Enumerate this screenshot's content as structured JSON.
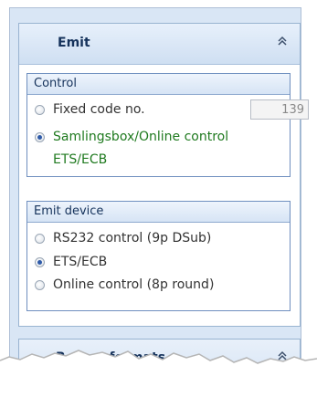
{
  "emit_panel": {
    "title": "Emit",
    "collapse_icon": "double-chevron-up-icon",
    "collapse_glyph": "≈"
  },
  "control_group": {
    "title": "Control",
    "options": [
      {
        "label": "Fixed code no.",
        "checked": false,
        "color": "#333333"
      },
      {
        "label": "Samlingsbox/Online control",
        "label2": "ETS/ECB",
        "checked": true,
        "color": "#1f7a1f"
      }
    ],
    "code_value": "139"
  },
  "emit_device_group": {
    "title": "Emit device",
    "options": [
      {
        "label": "RS232 control (9p DSub)",
        "checked": false
      },
      {
        "label": "ETS/ECB",
        "checked": true
      },
      {
        "label": "Online control (8p round)",
        "checked": false
      }
    ]
  },
  "report_panel": {
    "title": "Report formats",
    "collapse_icon": "double-chevron-up-icon"
  },
  "colors": {
    "panel_bg": "#d9e6f5",
    "header_text": "#15325b",
    "selected_green": "#1f7a1f"
  }
}
